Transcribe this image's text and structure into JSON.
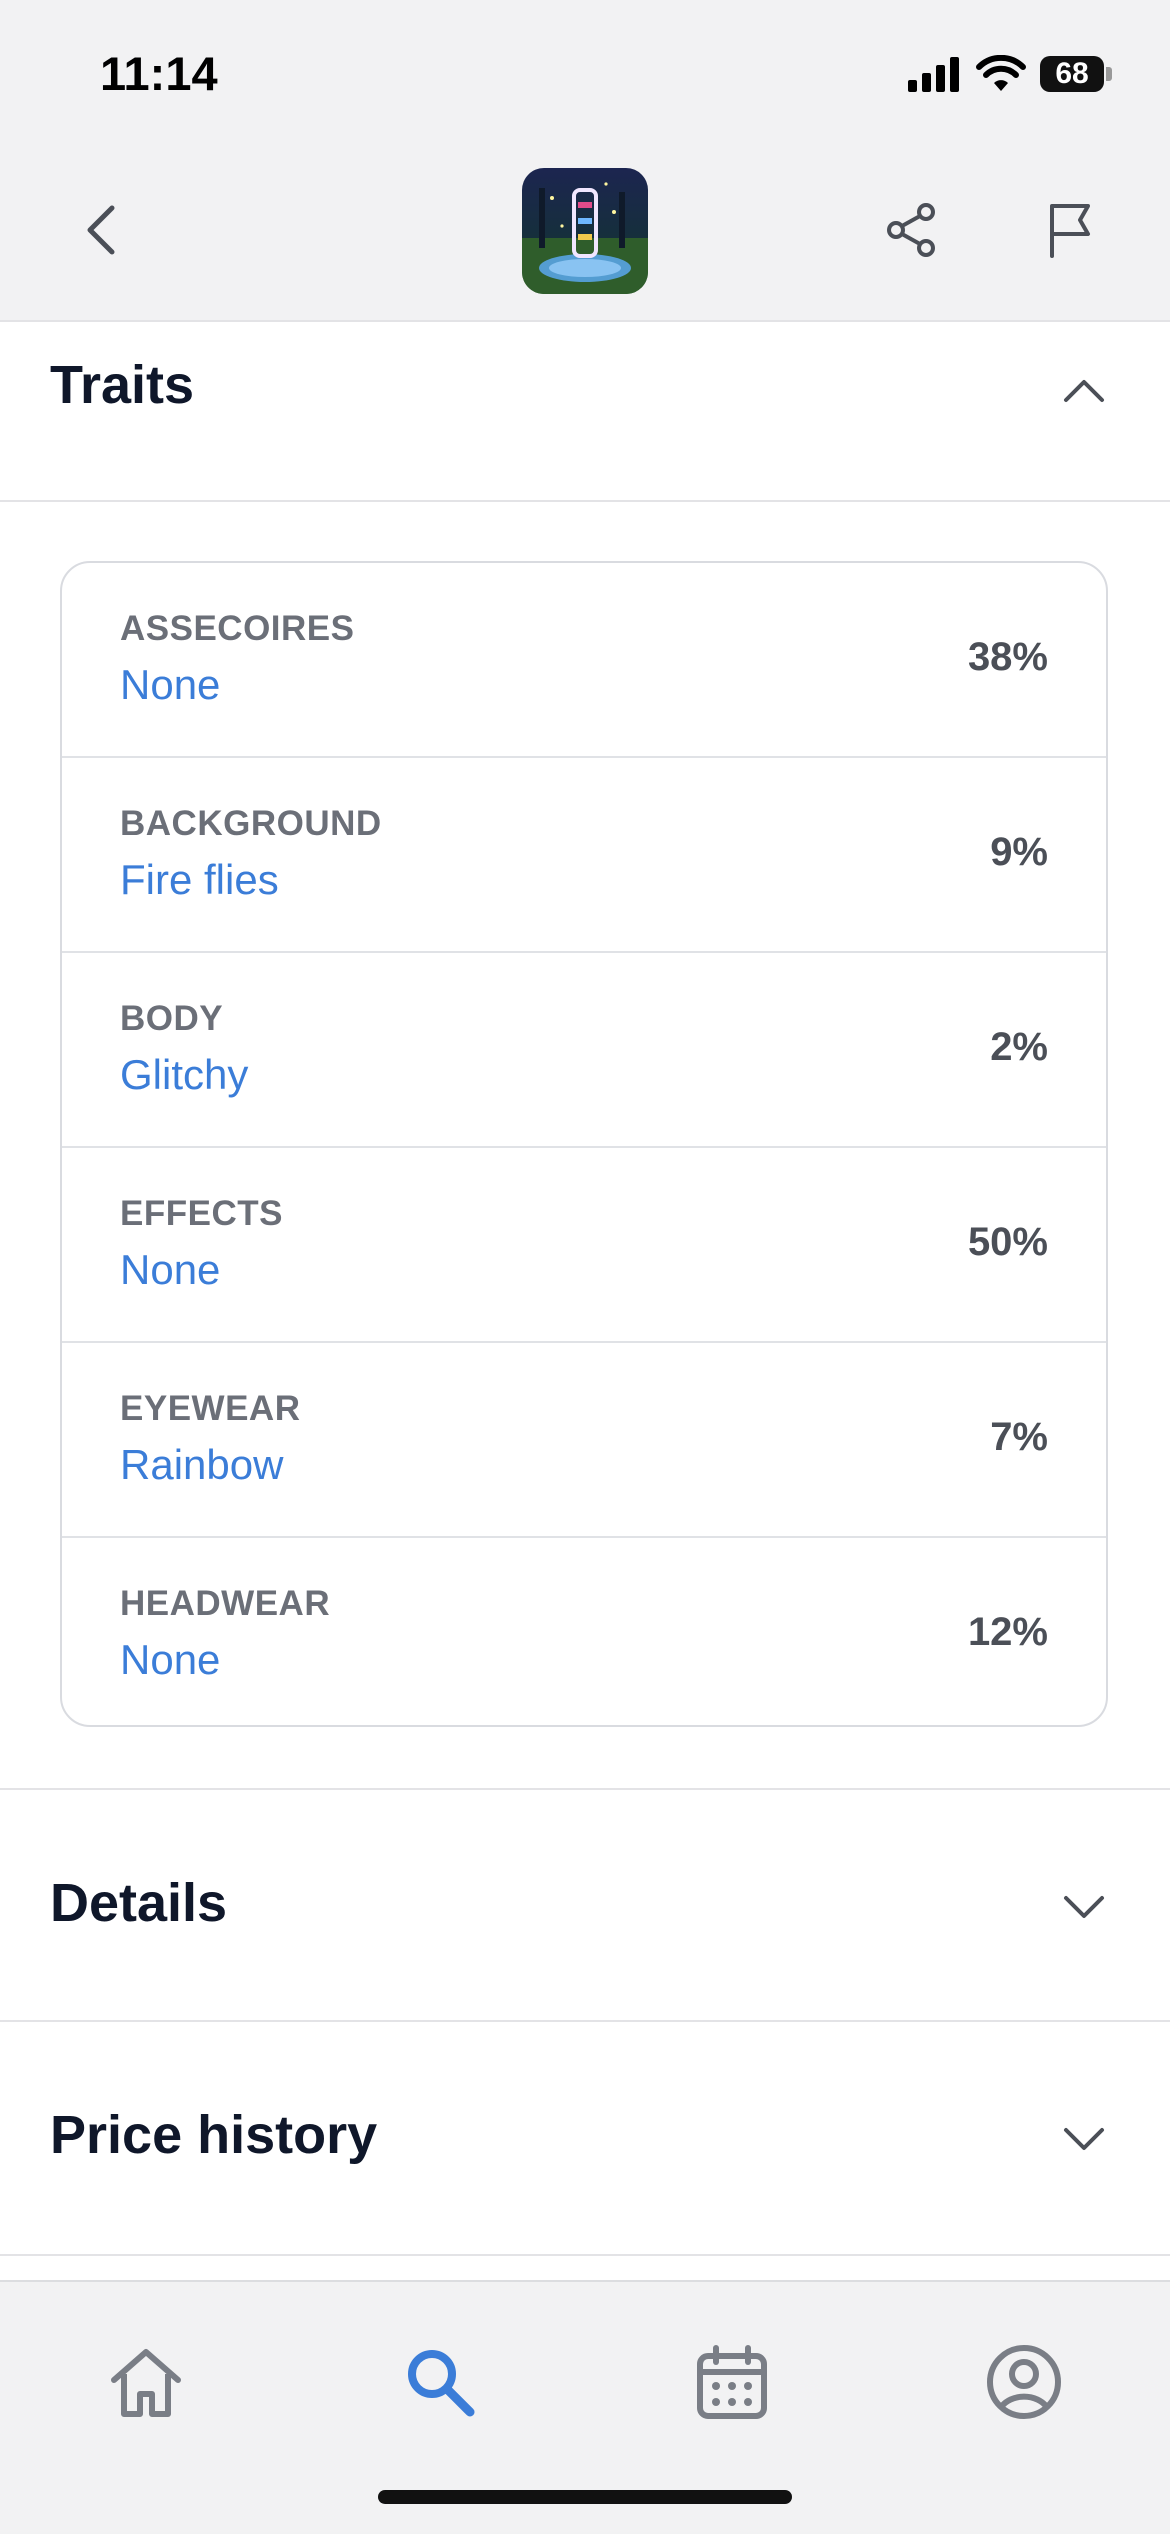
{
  "status_bar": {
    "time": "11:14",
    "battery": "68",
    "icons": [
      "signal-icon",
      "wifi-icon",
      "battery-icon"
    ]
  },
  "nav": {
    "icons": [
      "back-chevron-icon",
      "nft-thumbnail",
      "share-icon",
      "flag-icon"
    ]
  },
  "sections": {
    "traits_title": "Traits",
    "details_title": "Details",
    "price_history_title": "Price history"
  },
  "traits": [
    {
      "name": "ASSECOIRES",
      "value": "None",
      "percent": "38%"
    },
    {
      "name": "BACKGROUND",
      "value": "Fire flies",
      "percent": "9%"
    },
    {
      "name": "BODY",
      "value": "Glitchy",
      "percent": "2%"
    },
    {
      "name": "EFFECTS",
      "value": "None",
      "percent": "50%"
    },
    {
      "name": "EYEWEAR",
      "value": "Rainbow",
      "percent": "7%"
    },
    {
      "name": "HEADWEAR",
      "value": "None",
      "percent": "12%"
    }
  ],
  "tab_bar": {
    "items": [
      "home-icon",
      "search-icon",
      "calendar-icon",
      "profile-icon"
    ],
    "active": "search-icon"
  },
  "colors": {
    "accent": "#3b7dd8",
    "text_primary": "#0f172a",
    "text_secondary": "#6b6f78",
    "chrome_background": "#f2f2f3"
  }
}
